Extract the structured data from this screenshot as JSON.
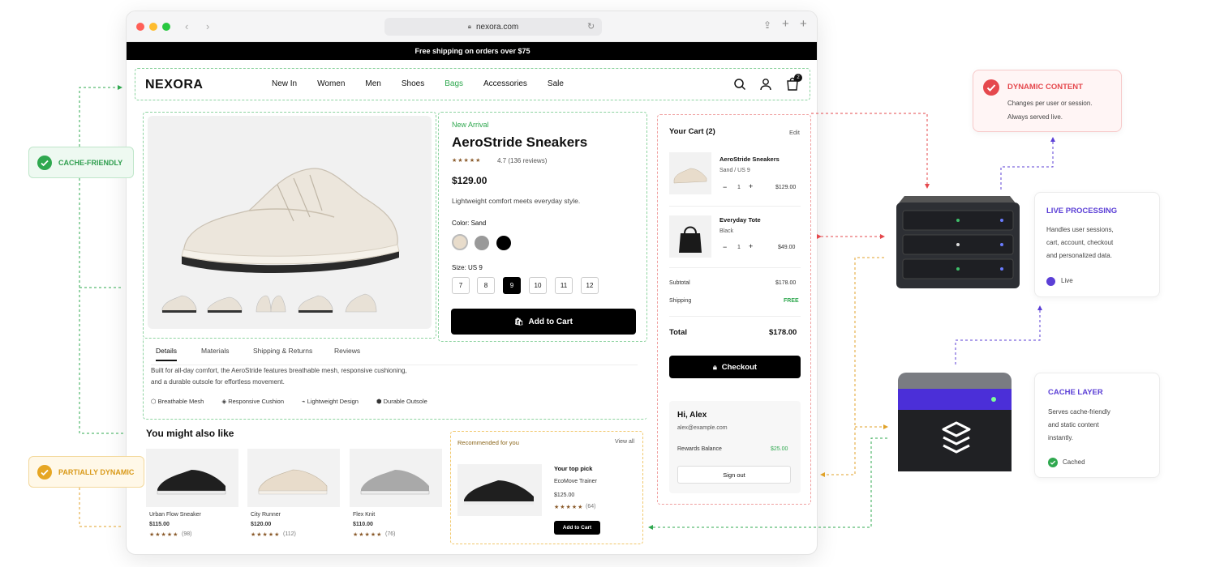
{
  "browser": {
    "url": "nexora.com"
  },
  "promo_text": "Free shipping on orders over $75",
  "header": {
    "logo": "NEXORA",
    "nav": [
      "New In",
      "Women",
      "Men",
      "Shoes",
      "Bags",
      "Accessories",
      "Sale"
    ],
    "cart_count": "2"
  },
  "product": {
    "tag": "New Arrival",
    "name": "AeroStride Sneakers",
    "rating_text": "4.7 (136 reviews)",
    "price": "$129.00",
    "desc": "Lightweight comfort meets everyday style.",
    "color_label": "Color: Sand",
    "size_label": "Size: US 9",
    "sizes": [
      "7",
      "8",
      "9",
      "10",
      "11",
      "12"
    ],
    "selected_size": "9",
    "add_to_cart": "Add to Cart"
  },
  "details": {
    "tabs": [
      "Details",
      "Materials",
      "Shipping & Returns",
      "Reviews"
    ],
    "text_line1": "Built for all-day comfort, the AeroStride features breathable mesh, responsive cushioning,",
    "text_line2": "and a durable outsole for effortless movement.",
    "features": [
      "Breathable Mesh",
      "Responsive Cushion",
      "Lightweight Design",
      "Durable Outsole"
    ]
  },
  "also_like": {
    "title": "You might also like",
    "items": [
      {
        "name": "Urban Flow Sneaker",
        "price": "$115.00",
        "reviews": "(98)"
      },
      {
        "name": "City Runner",
        "price": "$120.00",
        "reviews": "(112)"
      },
      {
        "name": "Flex Knit",
        "price": "$110.00",
        "reviews": "(76)"
      }
    ]
  },
  "recommended": {
    "title": "Recommended for you",
    "view_all": "View all",
    "label": "Your top pick",
    "name": "EcoMove Trainer",
    "price": "$125.00",
    "reviews": "(64)",
    "button": "Add to Cart"
  },
  "cart": {
    "title": "Your Cart (2)",
    "edit": "Edit",
    "items": [
      {
        "name": "AeroStride Sneakers",
        "variant": "Sand / US 9",
        "qty": "1",
        "price": "$129.00"
      },
      {
        "name": "Everyday Tote",
        "variant": "Black",
        "qty": "1",
        "price": "$49.00"
      }
    ],
    "subtotal_label": "Subtotal",
    "subtotal": "$178.00",
    "shipping_label": "Shipping",
    "shipping": "FREE",
    "total_label": "Total",
    "total": "$178.00",
    "checkout": "Checkout"
  },
  "account": {
    "greeting": "Hi, Alex",
    "email": "alex@example.com",
    "rewards_label": "Rewards Balance",
    "rewards": "$25.00",
    "sign_out": "Sign out"
  },
  "labels": {
    "cache_friendly": "CACHE-FRIENDLY",
    "partially_dynamic": "PARTIALLY DYNAMIC"
  },
  "dynamic_box": {
    "title": "DYNAMIC CONTENT",
    "line1": "Changes per user or session.",
    "line2": "Always served live."
  },
  "live_box": {
    "title": "LIVE PROCESSING",
    "line1": "Handles user sessions,",
    "line2": "cart, account, checkout",
    "line3": "and personalized data.",
    "status": "Live"
  },
  "cache_box": {
    "title": "CACHE LAYER",
    "line1": "Serves cache-friendly",
    "line2": "and static content",
    "line3": "instantly.",
    "status": "Cached"
  },
  "colors": {
    "green": "#2fa84f",
    "red": "#e5484d",
    "amber": "#e0a228",
    "purple": "#5b3fd6"
  }
}
